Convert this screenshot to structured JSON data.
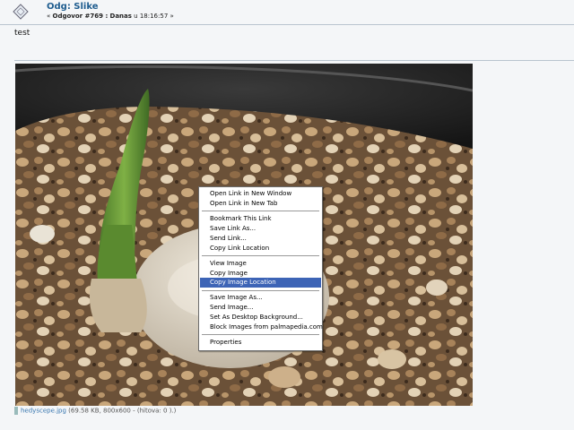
{
  "post": {
    "title": "Odg: Slike",
    "meta_prefix": "« ",
    "reply_label": "Odgovor #769 :",
    "author": "Danas",
    "time_prefix": " u ",
    "time": "18:16:57",
    "meta_suffix": " »",
    "body": "test"
  },
  "image": {
    "filename": "hedyscepe.jpg",
    "info": " (69.58 KB, 800x600 - (hitova: 0 ).)"
  },
  "context_menu": {
    "items": [
      {
        "label": "Open Link in New Window"
      },
      {
        "label": "Open Link in New Tab"
      },
      {
        "label": "Bookmark This Link"
      },
      {
        "label": "Save Link As..."
      },
      {
        "label": "Send Link..."
      },
      {
        "label": "Copy Link Location"
      },
      {
        "label": "View Image"
      },
      {
        "label": "Copy Image"
      },
      {
        "label": "Copy Image Location",
        "highlighted": true
      },
      {
        "label": "Save Image As..."
      },
      {
        "label": "Send Image..."
      },
      {
        "label": "Set As Desktop Background..."
      },
      {
        "label": "Block Images from palmapedia.com"
      },
      {
        "label": "Properties"
      }
    ],
    "highlight_color": "#3d64b6"
  },
  "colors": {
    "title": "#1f5d8f",
    "link": "#3a78b0"
  }
}
